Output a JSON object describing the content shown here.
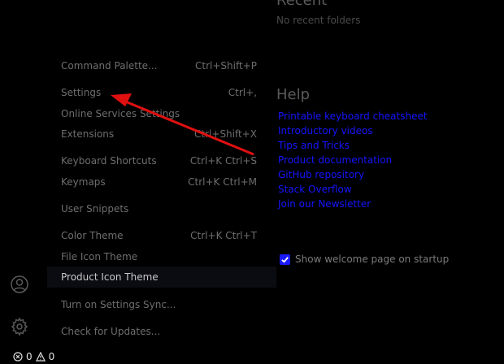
{
  "welcome": {
    "recent_title": "Recent",
    "recent_empty": "No recent folders",
    "help_title": "Help",
    "help_links": [
      "Printable keyboard cheatsheet",
      "Introductory videos",
      "Tips and Tricks",
      "Product documentation",
      "GitHub repository",
      "Stack Overflow",
      "Join our Newsletter"
    ],
    "show_on_startup_label": "Show welcome page on startup",
    "show_on_startup_checked": true
  },
  "menu": {
    "items": [
      {
        "label": "Command Palette...",
        "keys": "Ctrl+Shift+P"
      },
      {
        "label": "Settings",
        "keys": "Ctrl+,"
      },
      {
        "label": "Online Services Settings",
        "keys": ""
      },
      {
        "label": "Extensions",
        "keys": "Ctrl+Shift+X"
      },
      {
        "label": "Keyboard Shortcuts",
        "keys": "Ctrl+K Ctrl+S"
      },
      {
        "label": "Keymaps",
        "keys": "Ctrl+K Ctrl+M"
      },
      {
        "label": "User Snippets",
        "keys": ""
      },
      {
        "label": "Color Theme",
        "keys": "Ctrl+K Ctrl+T"
      },
      {
        "label": "File Icon Theme",
        "keys": ""
      },
      {
        "label": "Product Icon Theme",
        "keys": ""
      },
      {
        "label": "Turn on Settings Sync...",
        "keys": ""
      },
      {
        "label": "Check for Updates...",
        "keys": ""
      }
    ],
    "active_item": "Product Icon Theme"
  },
  "activity_bar": {
    "icons": [
      "account-icon",
      "manage-gear-icon"
    ]
  },
  "status_bar": {
    "errors": "0",
    "warnings": "0"
  },
  "colors": {
    "background": "#000000",
    "link": "#1515ff",
    "arrow": "#e01010"
  }
}
